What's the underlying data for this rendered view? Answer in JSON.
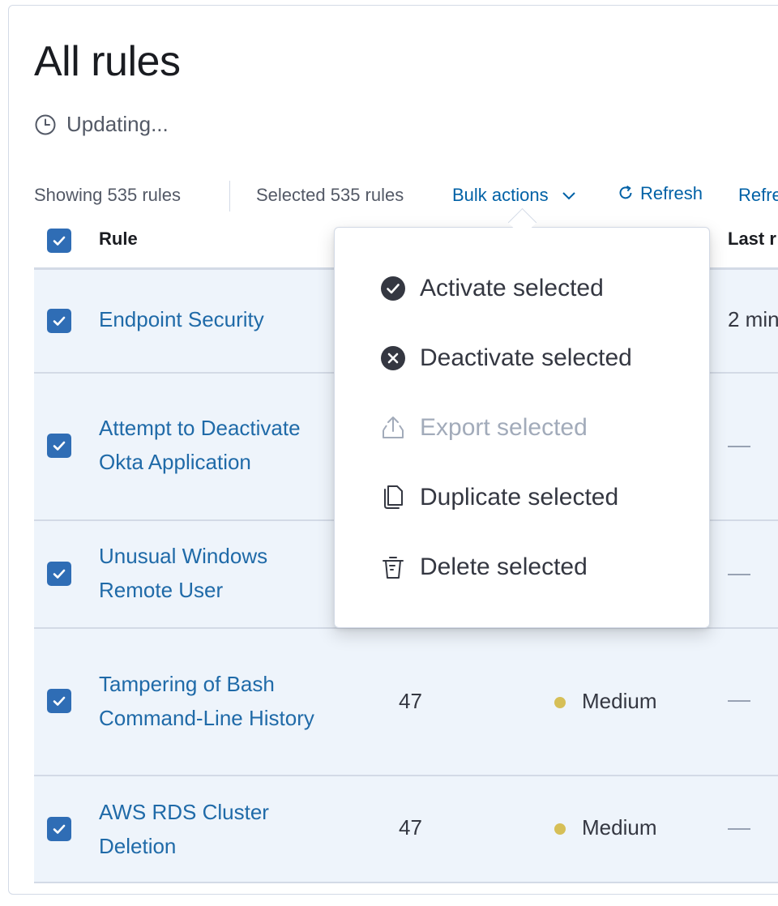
{
  "page": {
    "title": "All rules",
    "status_text": "Updating..."
  },
  "toolbar": {
    "showing": "Showing 535 rules",
    "selected": "Selected 535 rules",
    "bulk_actions": "Bulk actions",
    "refresh": "Refresh",
    "refresh_settings": "Refre"
  },
  "table": {
    "headers": {
      "rule": "Rule",
      "last_response": "Last r"
    },
    "rows": [
      {
        "rule": "Endpoint Security",
        "last_response": "2 min",
        "selected": true
      },
      {
        "rule": "Attempt to Deactivate Okta Application",
        "last_response": "—",
        "selected": true
      },
      {
        "rule": "Unusual Windows Remote User",
        "last_response": "—",
        "selected": true
      },
      {
        "rule": "Tampering of Bash Command-Line History",
        "risk_score": "47",
        "severity": "Medium",
        "last_response": "—",
        "selected": true
      },
      {
        "rule": "AWS RDS Cluster Deletion",
        "risk_score": "47",
        "severity": "Medium",
        "last_response": "—",
        "selected": true
      }
    ]
  },
  "bulk_menu": {
    "items": [
      {
        "label": "Activate selected",
        "icon": "check-circle-icon",
        "disabled": false
      },
      {
        "label": "Deactivate selected",
        "icon": "cross-circle-icon",
        "disabled": false
      },
      {
        "label": "Export selected",
        "icon": "export-icon",
        "disabled": true
      },
      {
        "label": "Duplicate selected",
        "icon": "copy-icon",
        "disabled": false
      },
      {
        "label": "Delete selected",
        "icon": "trash-icon",
        "disabled": false
      }
    ]
  },
  "colors": {
    "link": "#0061a6",
    "checkbox": "#2f6db5",
    "row_selected_bg": "#eef4fb",
    "severity_medium": "#d6bf57"
  }
}
